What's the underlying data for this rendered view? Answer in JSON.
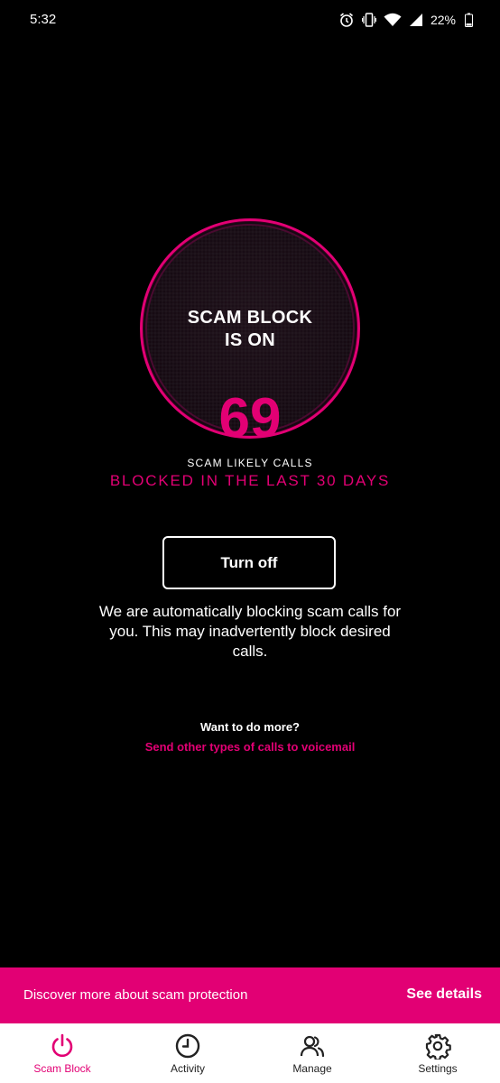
{
  "status_bar": {
    "time": "5:32",
    "battery": "22%",
    "icons": [
      "alarm-icon",
      "vibrate-icon",
      "wifi-icon",
      "signal-icon",
      "battery-icon"
    ]
  },
  "scam_block": {
    "title_line1": "SCAM BLOCK",
    "title_line2": "IS ON",
    "count": "69",
    "count_label": "SCAM LIKELY CALLS",
    "period_label": "BLOCKED IN THE LAST 30 DAYS",
    "turn_off_label": "Turn off",
    "description": "We are automatically blocking scam calls for you. This may inadvertently block desired calls.",
    "more_title": "Want to do more?",
    "more_link": "Send other types of calls to voicemail"
  },
  "banner": {
    "text": "Discover more about scam protection",
    "link": "See details"
  },
  "nav": {
    "items": [
      {
        "label": "Scam Block",
        "icon": "power-icon",
        "active": true
      },
      {
        "label": "Activity",
        "icon": "clock-icon",
        "active": false
      },
      {
        "label": "Manage",
        "icon": "people-icon",
        "active": false
      },
      {
        "label": "Settings",
        "icon": "gear-icon",
        "active": false
      }
    ]
  },
  "colors": {
    "accent": "#e20074",
    "background": "#000000",
    "nav_background": "#ffffff"
  }
}
